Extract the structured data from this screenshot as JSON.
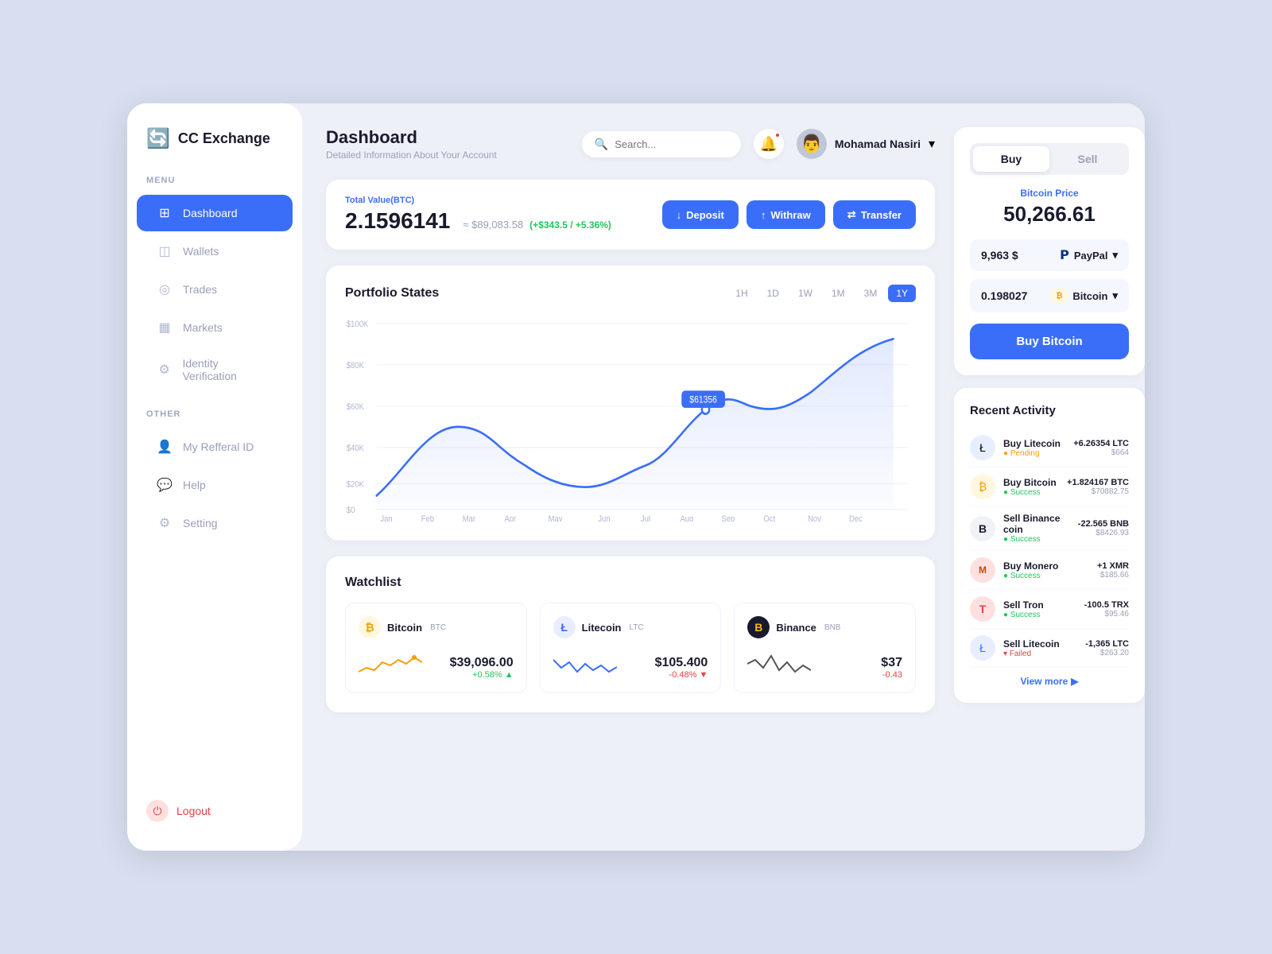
{
  "app": {
    "logo_text": "CC Exchange",
    "logo_icon": "⟳"
  },
  "sidebar": {
    "menu_label": "MENU",
    "other_label": "OTHER",
    "items_menu": [
      {
        "label": "Dashboard",
        "icon": "⊞",
        "active": true
      },
      {
        "label": "Wallets",
        "icon": "◫"
      },
      {
        "label": "Trades",
        "icon": "◎"
      },
      {
        "label": "Markets",
        "icon": "▦"
      },
      {
        "label": "Identity Verification",
        "icon": "⚙"
      }
    ],
    "items_other": [
      {
        "label": "My Refferal ID",
        "icon": "👤"
      },
      {
        "label": "Help",
        "icon": "💬"
      },
      {
        "label": "Setting",
        "icon": "⚙"
      }
    ],
    "logout_label": "Logout"
  },
  "header": {
    "title": "Dashboard",
    "subtitle": "Detailed Information About Your Account",
    "search_placeholder": "Search...",
    "user_name": "Mohamad Nasiri"
  },
  "balance": {
    "label": "Total Value(BTC)",
    "value": "2.1596141",
    "usd_equiv": "≈ $89,083.58",
    "change": "(+$343.5 / +5.36%)",
    "btn_deposit": "Deposit",
    "btn_withdraw": "Withraw",
    "btn_transfer": "Transfer"
  },
  "portfolio": {
    "title": "Portfolio States",
    "time_filters": [
      "1H",
      "1D",
      "1W",
      "1M",
      "3M",
      "1Y"
    ],
    "active_filter": "1Y",
    "tooltip_value": "$61356",
    "y_labels": [
      "$100K",
      "$80K",
      "$60K",
      "$40K",
      "$20K",
      "$0"
    ],
    "x_labels": [
      "Jan",
      "Feb",
      "Mar",
      "Apr",
      "May",
      "Jun",
      "Jul",
      "Aug",
      "Sep",
      "Oct",
      "Nov",
      "Dec"
    ]
  },
  "watchlist": {
    "title": "Watchlist",
    "items": [
      {
        "name": "Bitcoin",
        "ticker": "BTC",
        "icon_color": "#f59e0b",
        "icon_text": "₿",
        "price": "$39,096.00",
        "change": "+0.58% ▲",
        "change_positive": true
      },
      {
        "name": "Litecoin",
        "ticker": "LTC",
        "icon_color": "#3b6ef8",
        "icon_text": "Ł",
        "price": "$105.400",
        "change": "-0.48% ▼",
        "change_positive": false
      },
      {
        "name": "Binance",
        "ticker": "BNB",
        "icon_color": "#1a1a2e",
        "icon_text": "B",
        "price": "$37",
        "change": "-0.43",
        "change_positive": false
      }
    ]
  },
  "buy_sell": {
    "tab_buy": "Buy",
    "tab_sell": "Sell",
    "btc_price_label": "Bitcoin Price",
    "btc_price": "50,266.61",
    "input_usd_value": "9,963 $",
    "input_usd_currency": "PayPal",
    "input_btc_value": "0.198027",
    "input_btc_currency": "Bitcoin",
    "btn_label": "Buy Bitcoin"
  },
  "recent_activity": {
    "title": "Recent Activity",
    "items": [
      {
        "name": "Buy Litecoin",
        "status": "Pending",
        "status_type": "pending",
        "icon_color": "#3b6ef8",
        "icon_text": "Ł",
        "crypto": "+6.26354 LTC",
        "usd": "$664"
      },
      {
        "name": "Buy Bitcoin",
        "status": "Success",
        "status_type": "success",
        "icon_color": "#f59e0b",
        "icon_text": "₿",
        "crypto": "+1.824167 BTC",
        "usd": "$70882.75"
      },
      {
        "name": "Sell Binance coin",
        "status": "Success",
        "status_type": "success",
        "icon_color": "#1a1a2e",
        "icon_text": "B",
        "crypto": "-22.565 BNB",
        "usd": "$8426.93"
      },
      {
        "name": "Buy Monero",
        "status": "Success",
        "status_type": "success",
        "icon_color": "#e84040",
        "icon_text": "M",
        "crypto": "+1 XMR",
        "usd": "$185.66"
      },
      {
        "name": "Sell Tron",
        "status": "Success",
        "status_type": "success",
        "icon_color": "#e84040",
        "icon_text": "T",
        "crypto": "-100.5 TRX",
        "usd": "$95.46"
      },
      {
        "name": "Sell Litecoin",
        "status": "Failed",
        "status_type": "failed",
        "icon_color": "#3b6ef8",
        "icon_text": "Ł",
        "crypto": "-1,365 LTC",
        "usd": "$263.20"
      }
    ],
    "view_more": "View more"
  }
}
